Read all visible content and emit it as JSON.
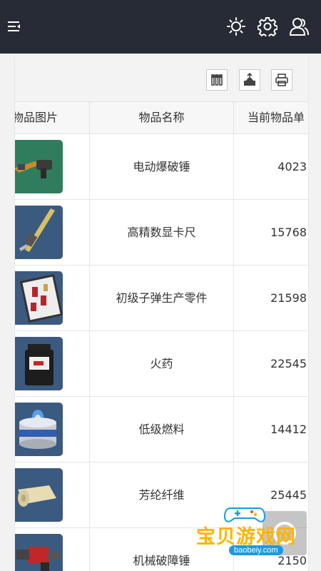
{
  "header": {
    "menu_icon": "menu-collapse-icon",
    "theme_icon": "sun-icon",
    "settings_icon": "gear-icon",
    "user_icon": "user-icon",
    "background": "#262b35"
  },
  "toolbar": {
    "columns_icon": "columns-icon",
    "export_icon": "export-icon",
    "print_icon": "print-icon"
  },
  "table": {
    "columns": [
      "物品图片",
      "物品名称",
      "当前物品单"
    ],
    "rows": [
      {
        "name": "电动爆破锤",
        "price": "4023",
        "thumb_color": "#2f7d5c"
      },
      {
        "name": "高精数显卡尺",
        "price": "15768",
        "thumb_color": "#3b5a80"
      },
      {
        "name": "初级子弹生产零件",
        "price": "21598",
        "thumb_color": "#3b5a80"
      },
      {
        "name": "火药",
        "price": "22545",
        "thumb_color": "#3b5a80"
      },
      {
        "name": "低级燃料",
        "price": "14412",
        "thumb_color": "#3b5a80"
      },
      {
        "name": "芳纶纤维",
        "price": "25445",
        "thumb_color": "#3b5a80"
      },
      {
        "name": "机械破障锤",
        "price": "2150",
        "thumb_color": "#3b5a80"
      }
    ]
  },
  "watermark": {
    "text": "宝贝游戏网",
    "url": "baobeiy.com"
  }
}
